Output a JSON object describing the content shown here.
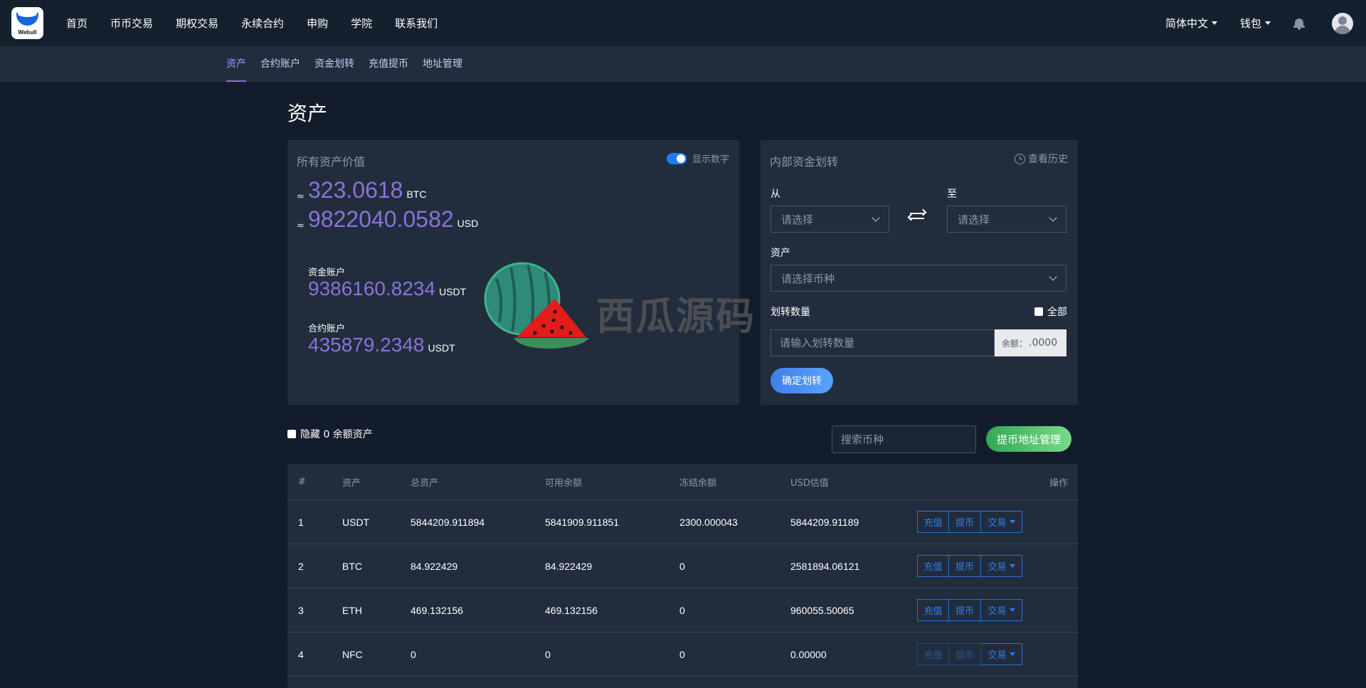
{
  "nav": {
    "logo_text": "Webull",
    "menu": [
      "首页",
      "币币交易",
      "期权交易",
      "永续合约",
      "申购",
      "学院",
      "联系我们"
    ],
    "language": "简体中文",
    "wallet": "钱包"
  },
  "subnav": {
    "items": [
      "资产",
      "合约账户",
      "资金划转",
      "充值提币",
      "地址管理"
    ],
    "active_index": 0
  },
  "page_title": "资产",
  "assets_panel": {
    "title": "所有资产价值",
    "toggle_label": "显示数字",
    "toggle_on": true,
    "approx_symbol": "≈",
    "btc_value": "323.0618",
    "btc_unit": "BTC",
    "usd_value": "9822040.0582",
    "usd_unit": "USD",
    "fund_account_label": "资金账户",
    "fund_account_value": "9386160.8234",
    "fund_account_unit": "USDT",
    "contract_account_label": "合约账户",
    "contract_account_value": "435879.2348",
    "contract_account_unit": "USDT"
  },
  "transfer_panel": {
    "title": "内部资金划转",
    "history_label": "查看历史",
    "from_label": "从",
    "from_placeholder": "请选择",
    "to_label": "至",
    "to_placeholder": "请选择",
    "asset_label": "资产",
    "asset_placeholder": "请选择币种",
    "amount_label": "划转数量",
    "all_label": "全部",
    "amount_placeholder": "请输入划转数量",
    "balance_label": "余额：",
    "balance_value": ".0000",
    "confirm_label": "确定划转"
  },
  "watermark": {
    "text": "西瓜源码"
  },
  "toolbar": {
    "hide_zero_label": "隐藏 0 余额资产",
    "search_placeholder": "搜索币种",
    "address_button": "提币地址管理"
  },
  "table": {
    "headers": {
      "idx": "#",
      "asset": "资产",
      "total": "总资产",
      "available": "可用余额",
      "frozen": "冻结余额",
      "usd": "USD估值",
      "op": "操作"
    },
    "action_labels": {
      "deposit": "充值",
      "withdraw": "提币",
      "trade": "交易"
    },
    "rows": [
      {
        "idx": "1",
        "asset": "USDT",
        "total": "5844209.911894",
        "available": "5841909.911851",
        "frozen": "2300.000043",
        "usd": "5844209.91189",
        "disabled": false
      },
      {
        "idx": "2",
        "asset": "BTC",
        "total": "84.922429",
        "available": "84.922429",
        "frozen": "0",
        "usd": "2581894.06121",
        "disabled": false
      },
      {
        "idx": "3",
        "asset": "ETH",
        "total": "469.132156",
        "available": "469.132156",
        "frozen": "0",
        "usd": "960055.50065",
        "disabled": false
      },
      {
        "idx": "4",
        "asset": "NFC",
        "total": "0",
        "available": "0",
        "frozen": "0",
        "usd": "0.00000",
        "disabled": true
      }
    ]
  }
}
